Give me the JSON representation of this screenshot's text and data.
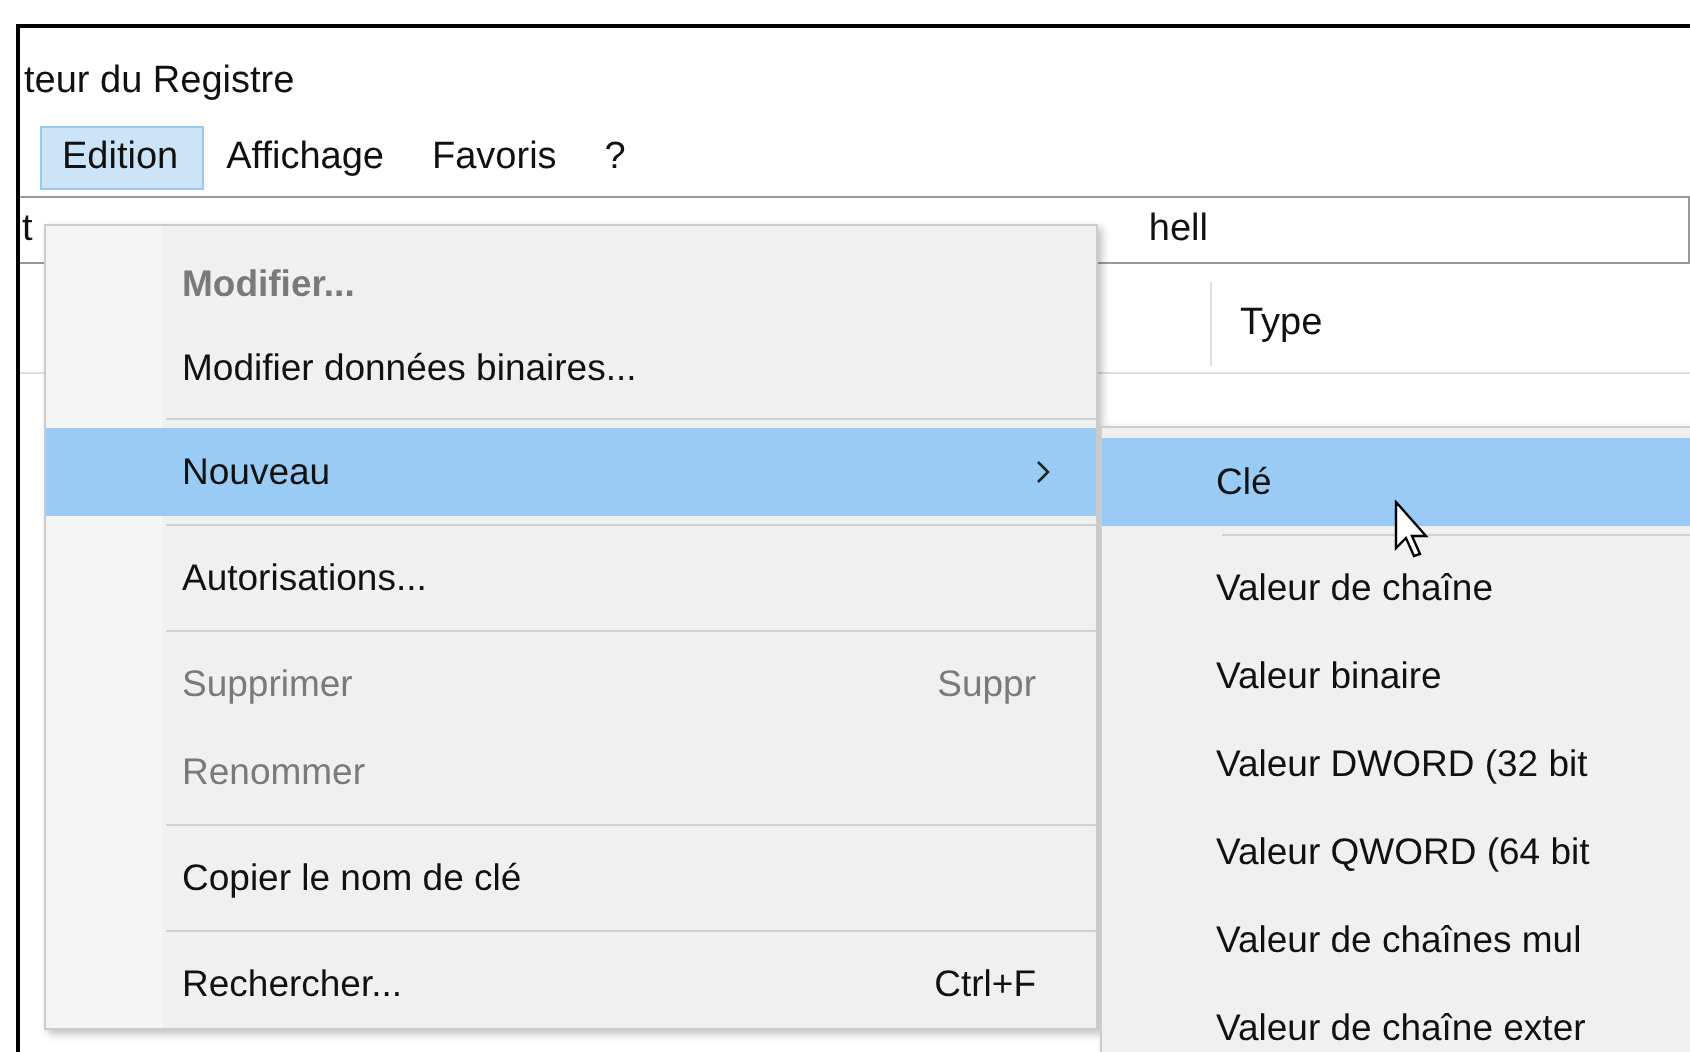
{
  "window": {
    "title": "teur du Registre"
  },
  "menubar": [
    {
      "label": "Edition",
      "selected": true
    },
    {
      "label": "Affichage",
      "selected": false
    },
    {
      "label": "Favoris",
      "selected": false
    },
    {
      "label": "?",
      "selected": false
    }
  ],
  "address_bar": {
    "value_start": "t",
    "value_end": "hell"
  },
  "list_header": {
    "columns": [
      "Type"
    ]
  },
  "edit_menu": [
    {
      "kind": "item",
      "label": "Modifier...",
      "bold": true,
      "disabled": true,
      "selected": false
    },
    {
      "kind": "item",
      "label": "Modifier données binaires...",
      "disabled": false,
      "selected": false
    },
    {
      "kind": "separator"
    },
    {
      "kind": "item",
      "label": "Nouveau",
      "disabled": false,
      "selected": true,
      "submenu": true
    },
    {
      "kind": "separator"
    },
    {
      "kind": "item",
      "label": "Autorisations...",
      "disabled": false,
      "selected": false
    },
    {
      "kind": "separator"
    },
    {
      "kind": "item",
      "label": "Supprimer",
      "shortcut": "Suppr",
      "disabled": true,
      "selected": false
    },
    {
      "kind": "item",
      "label": "Renommer",
      "disabled": true,
      "selected": false
    },
    {
      "kind": "separator"
    },
    {
      "kind": "item",
      "label": "Copier le nom de clé",
      "disabled": false,
      "selected": false
    },
    {
      "kind": "separator"
    },
    {
      "kind": "item",
      "label": "Rechercher...",
      "shortcut": "Ctrl+F",
      "disabled": false,
      "selected": false
    }
  ],
  "new_submenu": [
    {
      "kind": "item",
      "label": "Clé",
      "selected": true
    },
    {
      "kind": "separator"
    },
    {
      "kind": "item",
      "label": "Valeur de chaîne",
      "selected": false
    },
    {
      "kind": "item",
      "label": "Valeur binaire",
      "selected": false
    },
    {
      "kind": "item",
      "label": "Valeur DWORD (32 bit",
      "selected": false
    },
    {
      "kind": "item",
      "label": "Valeur QWORD (64 bit",
      "selected": false
    },
    {
      "kind": "item",
      "label": "Valeur de chaînes mul",
      "selected": false
    },
    {
      "kind": "item",
      "label": "Valeur de chaîne exter",
      "selected": false
    }
  ]
}
